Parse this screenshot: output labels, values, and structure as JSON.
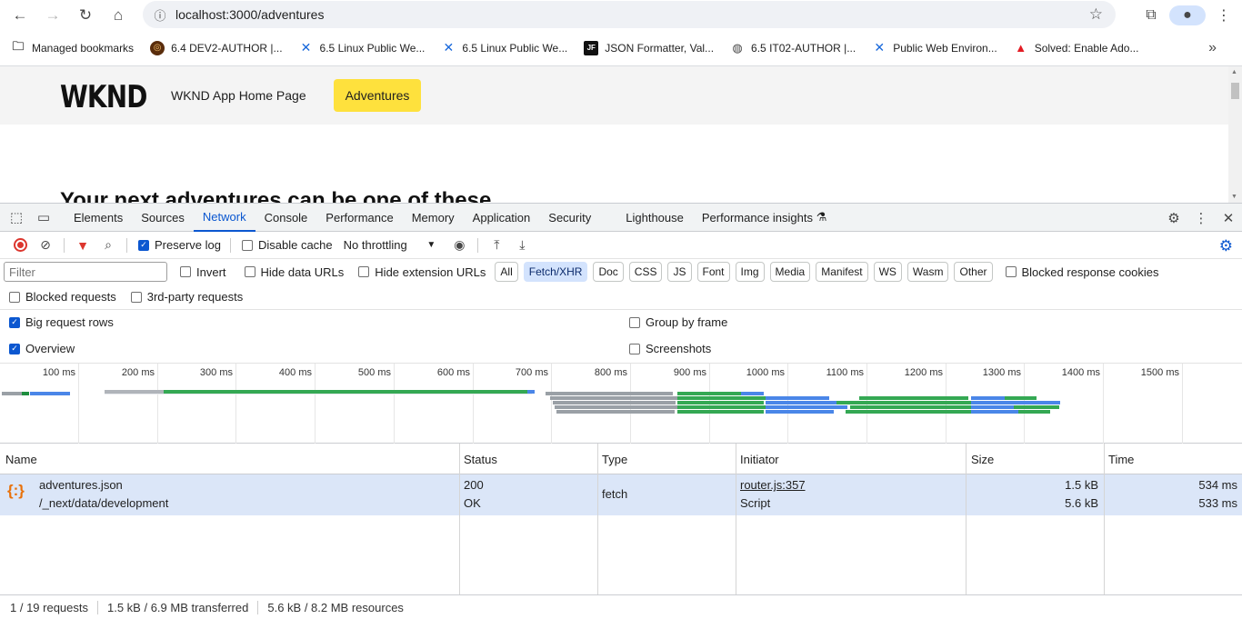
{
  "browser": {
    "url": "localhost:3000/adventures",
    "bookmarks": [
      {
        "label": "Managed bookmarks",
        "icon": "folder-icon"
      },
      {
        "label": "6.4 DEV2-AUTHOR |...",
        "icon": "aem-icon"
      },
      {
        "label": "6.5 Linux Public We...",
        "icon": "confluence-icon"
      },
      {
        "label": "6.5 Linux Public We...",
        "icon": "confluence-icon"
      },
      {
        "label": "JSON Formatter, Val...",
        "icon": "jf-icon",
        "icon_text": "JF"
      },
      {
        "label": "6.5 IT02-AUTHOR |...",
        "icon": "globe-icon"
      },
      {
        "label": "Public Web Environ...",
        "icon": "confluence-icon"
      },
      {
        "label": "Solved: Enable Ado...",
        "icon": "adobe-icon"
      }
    ]
  },
  "site": {
    "logo": "WKND",
    "nav_home": "WKND App Home Page",
    "nav_adventures": "Adventures",
    "headline": "Your next adventures can be one of these",
    "accent_color": "#fee13d"
  },
  "devtools": {
    "tabs": [
      "Elements",
      "Sources",
      "Network",
      "Console",
      "Performance",
      "Memory",
      "Application",
      "Security",
      "Lighthouse",
      "Performance insights"
    ],
    "active_tab": "Network",
    "toolbar": {
      "preserve_log": "Preserve log",
      "disable_cache": "Disable cache",
      "throttling": "No throttling"
    },
    "filter": {
      "placeholder": "Filter",
      "invert": "Invert",
      "hide_data_urls": "Hide data URLs",
      "hide_extension_urls": "Hide extension URLs",
      "types": [
        "All",
        "Fetch/XHR",
        "Doc",
        "CSS",
        "JS",
        "Font",
        "Img",
        "Media",
        "Manifest",
        "WS",
        "Wasm",
        "Other"
      ],
      "active_type": "Fetch/XHR",
      "blocked_response_cookies": "Blocked response cookies",
      "blocked_requests": "Blocked requests",
      "third_party": "3rd-party requests"
    },
    "options": {
      "big_request_rows": "Big request rows",
      "group_by_frame": "Group by frame",
      "overview": "Overview",
      "screenshots": "Screenshots"
    },
    "timeline_ticks": [
      "100 ms",
      "200 ms",
      "300 ms",
      "400 ms",
      "500 ms",
      "600 ms",
      "700 ms",
      "800 ms",
      "900 ms",
      "1000 ms",
      "1100 ms",
      "1200 ms",
      "1300 ms",
      "1400 ms",
      "1500 ms",
      "160"
    ],
    "columns": [
      "Name",
      "Status",
      "Type",
      "Initiator",
      "Size",
      "Time"
    ],
    "request": {
      "name": "adventures.json",
      "path": "/_next/data/development",
      "status_code": "200",
      "status_text": "OK",
      "type": "fetch",
      "initiator": "router.js:357",
      "initiator_type": "Script",
      "size_transferred": "1.5 kB",
      "size_resource": "5.6 kB",
      "time_total": "534 ms",
      "time_latency": "533 ms"
    },
    "status": {
      "requests": "1 / 19 requests",
      "transferred": "1.5 kB / 6.9 MB transferred",
      "resources": "5.6 kB / 8.2 MB resources"
    }
  }
}
